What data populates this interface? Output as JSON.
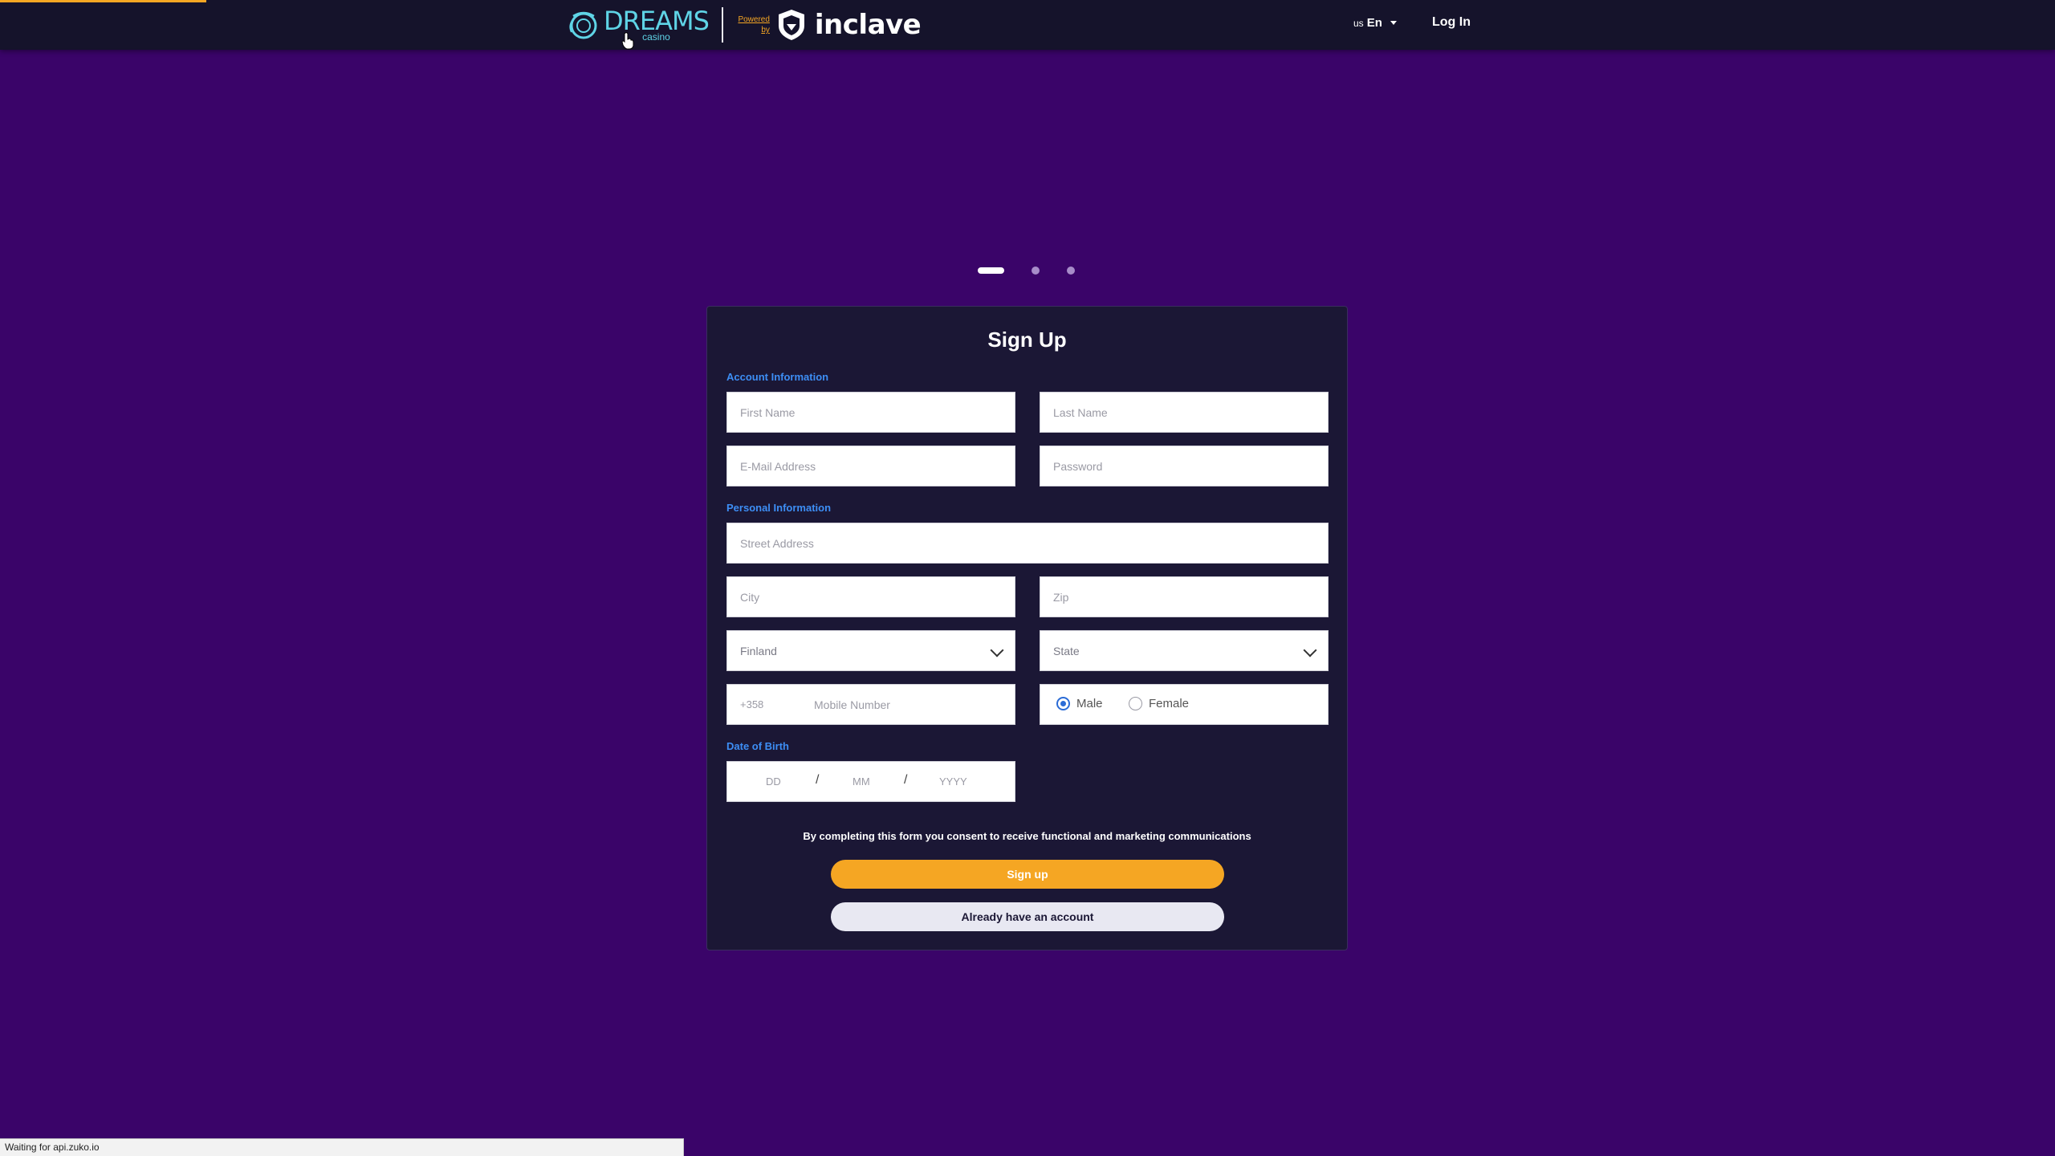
{
  "header": {
    "brand_name": "DREAMS",
    "brand_sub": "casino",
    "powered_by": "Powered by",
    "partner_name": "inclave",
    "lang_flag": "us",
    "lang_code": "En",
    "login_label": "Log In"
  },
  "carousel": {
    "slides": 3,
    "active": 1
  },
  "form": {
    "title": "Sign Up",
    "account_section": "Account Information",
    "first_name_placeholder": "First Name",
    "last_name_placeholder": "Last Name",
    "email_placeholder": "E-Mail Address",
    "password_placeholder": "Password",
    "personal_section": "Personal Information",
    "street_placeholder": "Street Address",
    "city_placeholder": "City",
    "zip_placeholder": "Zip",
    "country_value": "Finland",
    "state_value": "State",
    "phone_prefix": "+358",
    "mobile_placeholder": "Mobile Number",
    "gender_male": "Male",
    "gender_female": "Female",
    "gender_selected": "Male",
    "dob_section": "Date of Birth",
    "dob_day": "DD",
    "dob_month": "MM",
    "dob_year": "YYYY",
    "dob_sep": "/",
    "consent": "By completing this form you consent to receive functional and marketing communications",
    "signup_label": "Sign up",
    "account_label": "Already have an account"
  },
  "status_bar": {
    "text": "Waiting for api.zuko.io"
  },
  "colors": {
    "accent": "#f5a623",
    "background": "#3a0469",
    "card": "#1b1735",
    "section": "#3d8ef5"
  }
}
